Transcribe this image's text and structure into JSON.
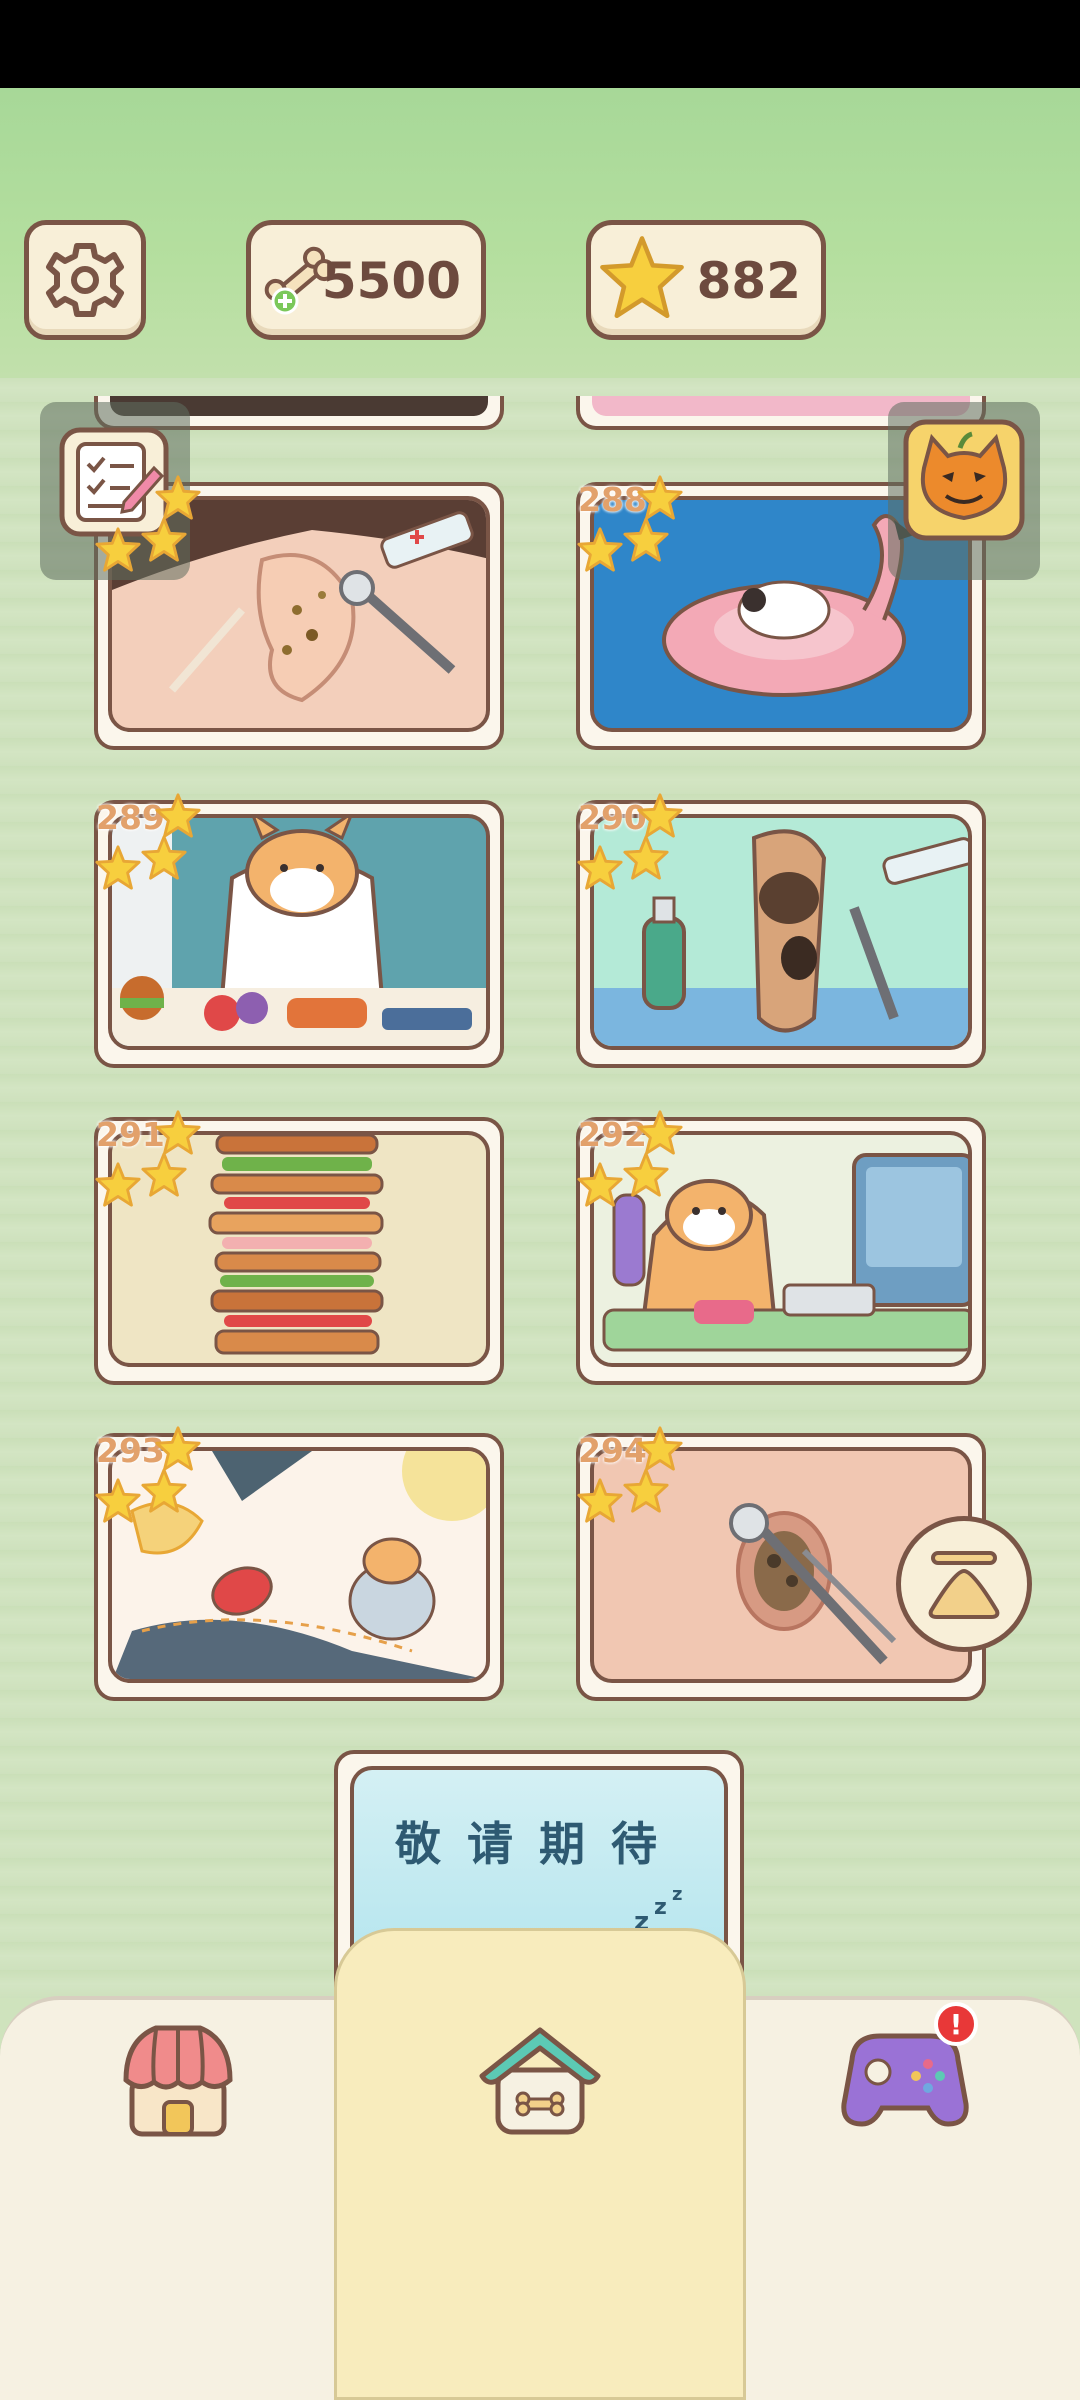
{
  "hud": {
    "bones_count": "5500",
    "stars_count": "882"
  },
  "levels": [
    {
      "number": "",
      "scene": "ear-cleaning",
      "stars": 3
    },
    {
      "number": "288",
      "scene": "cat-on-flamingo-float",
      "stars": 3
    },
    {
      "number": "289",
      "scene": "corgi-eating-feast",
      "stars": 3
    },
    {
      "number": "290",
      "scene": "foot-treatment",
      "stars": 3
    },
    {
      "number": "291",
      "scene": "tall-sandwich",
      "stars": 3
    },
    {
      "number": "292",
      "scene": "corgi-at-computer",
      "stars": 3
    },
    {
      "number": "293",
      "scene": "corgi-on-fabric",
      "stars": 3
    },
    {
      "number": "294",
      "scene": "belly-button-cleaning",
      "stars": 3
    }
  ],
  "coming_soon": {
    "label": "敬请期待"
  },
  "nav": {
    "items": [
      {
        "id": "shop",
        "icon": "shop-icon"
      },
      {
        "id": "home",
        "icon": "home-icon",
        "selected": true
      },
      {
        "id": "games",
        "icon": "gamepad-icon",
        "badge": "!"
      }
    ]
  },
  "colors": {
    "accent_brown": "#7a5546",
    "star_yellow": "#f7cf3e",
    "level_number": "#e2a16b",
    "nav_selected_bg": "#f8ecbd"
  }
}
